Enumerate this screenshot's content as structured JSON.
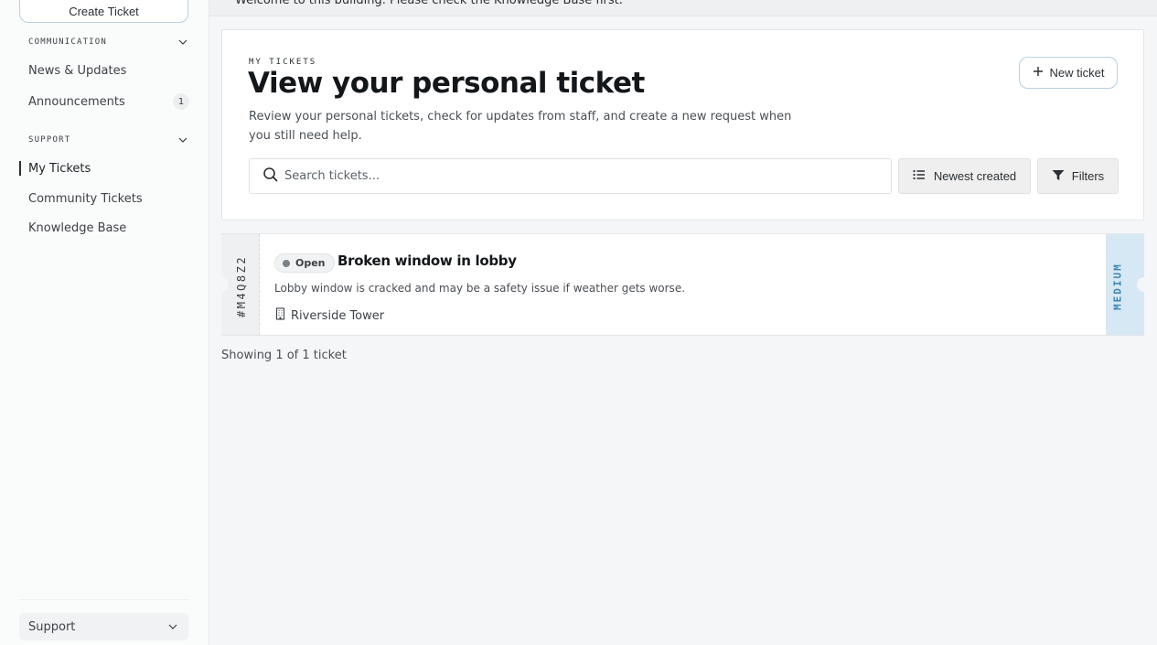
{
  "sidebar": {
    "create_ticket_label": "Create Ticket",
    "sections": [
      {
        "label": "COMMUNICATION",
        "items": [
          {
            "label": "News & Updates"
          },
          {
            "label": "Announcements",
            "badge": "1"
          }
        ]
      },
      {
        "label": "SUPPORT",
        "items": [
          {
            "label": "My Tickets",
            "active": true
          },
          {
            "label": "Community Tickets"
          },
          {
            "label": "Knowledge Base"
          }
        ]
      }
    ],
    "footer_select": "Support"
  },
  "banner": {
    "text": "Welcome to this building. Please check the Knowledge Base first."
  },
  "header": {
    "eyebrow": "MY TICKETS",
    "title": "View your personal ticket",
    "description": "Review your personal tickets, check for updates from staff, and create a new request when you still need help.",
    "new_ticket_label": "New ticket"
  },
  "toolbar": {
    "search_placeholder": "Search tickets...",
    "sort_label": "Newest created",
    "filters_label": "Filters"
  },
  "tickets": [
    {
      "id": "#M4Q8Z2",
      "status": "Open",
      "title": "Broken window in lobby",
      "description": "Lobby window is cracked and may be a safety issue if weather gets worse.",
      "location": "Riverside Tower",
      "priority": "MEDIUM"
    }
  ],
  "footer": {
    "showing": "Showing 1 of 1 ticket"
  },
  "colors": {
    "accent_border": "#b9cfe3",
    "priority_bg": "#d6e8f3",
    "priority_text": "#3e86b3"
  }
}
